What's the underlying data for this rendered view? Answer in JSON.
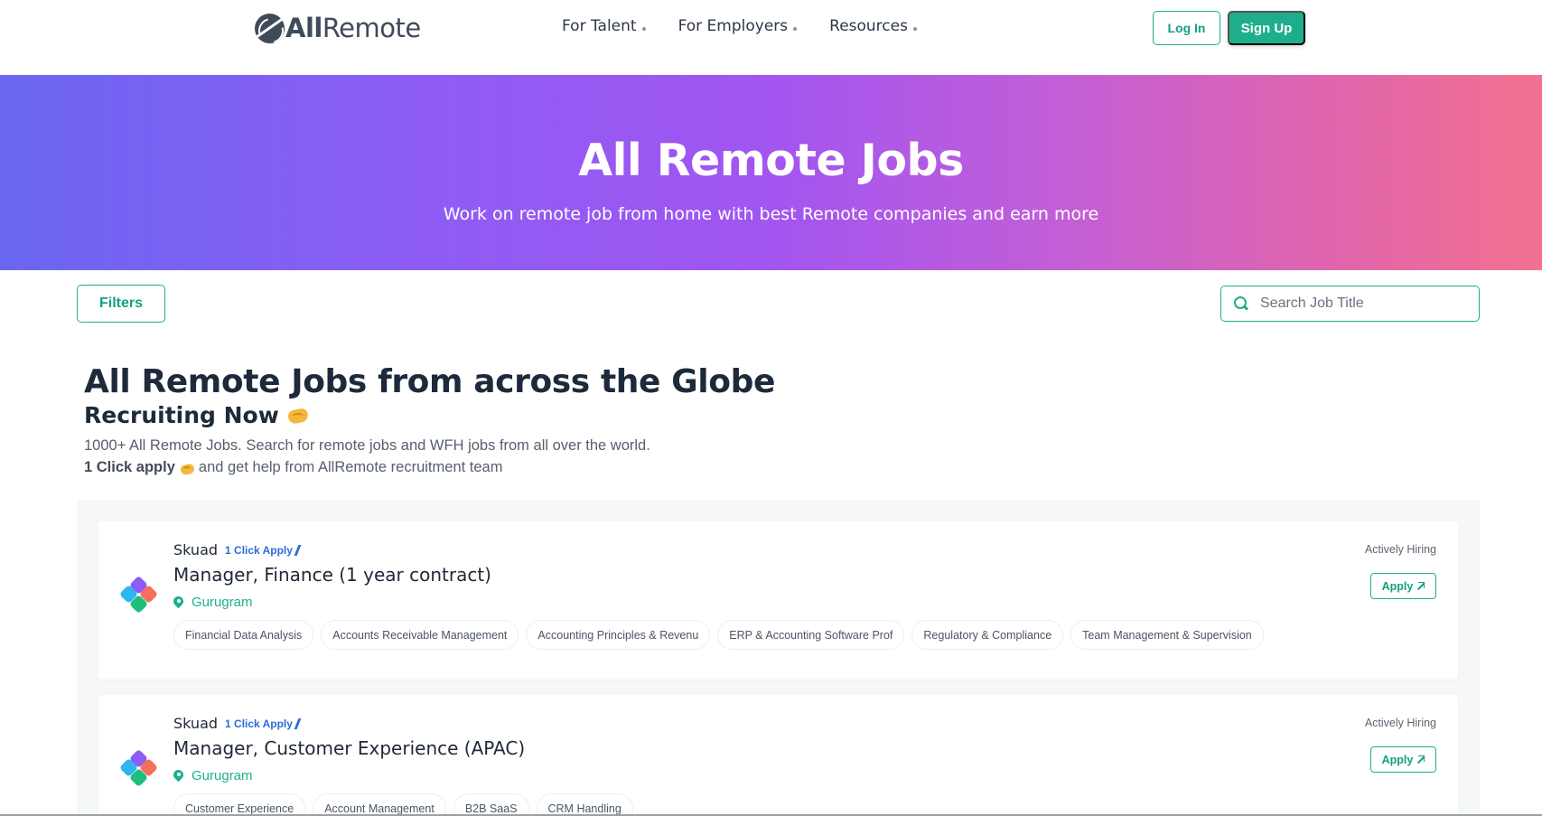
{
  "header": {
    "logo_bold": "All",
    "logo_light": "Remote",
    "nav": [
      {
        "label": "For Talent"
      },
      {
        "label": "For Employers"
      },
      {
        "label": "Resources"
      }
    ],
    "login_label": "Log In",
    "signup_label": "Sign Up"
  },
  "hero": {
    "title": "All Remote Jobs",
    "subtitle": "Work on remote job from home with best Remote companies and earn more"
  },
  "toolbar": {
    "filters_label": "Filters",
    "search_placeholder": "Search Job Title"
  },
  "intro": {
    "title": "All Remote Jobs from across the Globe",
    "subtitle": "Recruiting Now",
    "description": "1000+ All Remote Jobs. Search for remote jobs and WFH jobs from all over the world.",
    "apply_bold": "1 Click apply",
    "apply_rest": "and get help from AllRemote recruitment team"
  },
  "jobs": [
    {
      "company": "Skuad",
      "one_click": "1 Click Apply",
      "title": "Manager, Finance (1 year contract)",
      "location": "Gurugram",
      "status": "Actively Hiring",
      "apply_label": "Apply",
      "tags": [
        "Financial Data Analysis",
        "Accounts Receivable Management",
        "Accounting Principles & Revenu",
        "ERP & Accounting Software Prof",
        "Regulatory & Compliance",
        "Team Management & Supervision"
      ]
    },
    {
      "company": "Skuad",
      "one_click": "1 Click Apply",
      "title": "Manager, Customer Experience (APAC)",
      "location": "Gurugram",
      "status": "Actively Hiring",
      "apply_label": "Apply",
      "tags": [
        "Customer Experience",
        "Account Management",
        "B2B SaaS",
        "CRM Handling"
      ]
    }
  ],
  "colors": {
    "brand": "#1fae8c",
    "link": "#2b6cd8",
    "hero_start": "#6a66f0",
    "hero_end": "#f2718f"
  }
}
